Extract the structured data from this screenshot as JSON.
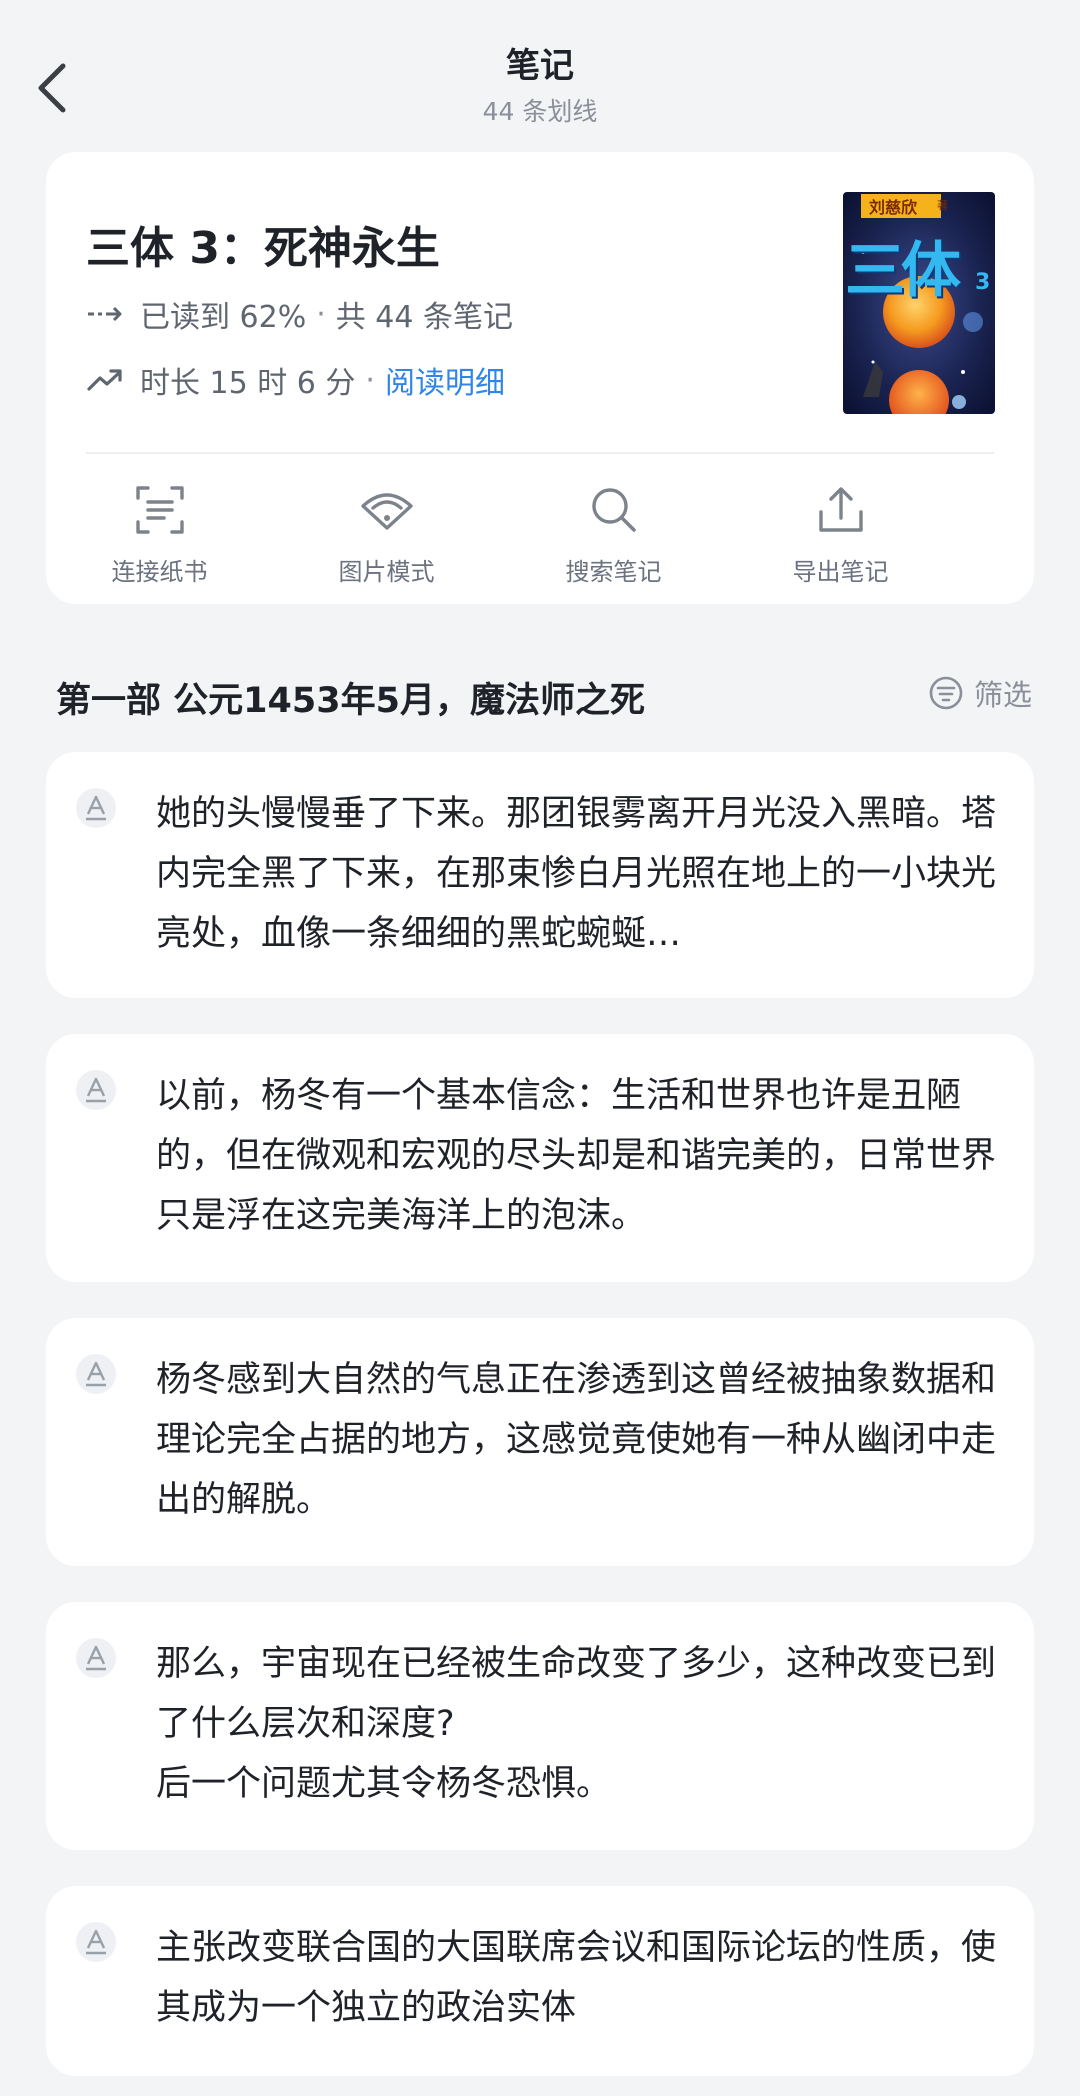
{
  "header": {
    "title": "笔记",
    "subtitle": "44 条划线"
  },
  "book": {
    "title": "三体 3：死神永生",
    "progress_text": "已读到 62%",
    "separator": "·",
    "notes_count_text": "共 44 条笔记",
    "duration_text": "时长 15 时 6 分",
    "reading_detail_link": "阅读明细",
    "cover": {
      "author": "刘慈欣",
      "author_suffix": "著",
      "title_art": "三体",
      "volume": "3"
    }
  },
  "actions": [
    {
      "label": "连接纸书",
      "icon": "scan-document-icon"
    },
    {
      "label": "图片模式",
      "icon": "fan-image-icon"
    },
    {
      "label": "搜索笔记",
      "icon": "search-icon"
    },
    {
      "label": "导出笔记",
      "icon": "export-icon"
    }
  ],
  "section": {
    "title": "第一部 公元1453年5月，魔法师之死",
    "filter_label": "筛选"
  },
  "notes": [
    {
      "text": "她的头慢慢垂了下来。那团银雾离开月光没入黑暗。塔内完全黑了下来，在那束惨白月光照在地上的一小块光亮处，血像一条细细的黑蛇蜿蜒…"
    },
    {
      "text": "以前，杨冬有一个基本信念：生活和世界也许是丑陋的，但在微观和宏观的尽头却是和谐完美的，日常世界只是浮在这完美海洋上的泡沫。"
    },
    {
      "text": "杨冬感到大自然的气息正在渗透到这曾经被抽象数据和理论完全占据的地方，这感觉竟使她有一种从幽闭中走出的解脱。"
    },
    {
      "text_line1": "那么，宇宙现在已经被生命改变了多少，这种改变已到了什么层次和深度?",
      "text_line2": "后一个问题尤其令杨冬恐惧。"
    },
    {
      "text": "主张改变联合国的大国联席会议和国际论坛的性质，使其成为一个独立的政治实体"
    }
  ],
  "colors": {
    "background": "#f3f4f6",
    "card": "#ffffff",
    "link": "#2f86e8",
    "secondary_text": "#8a8f99"
  }
}
